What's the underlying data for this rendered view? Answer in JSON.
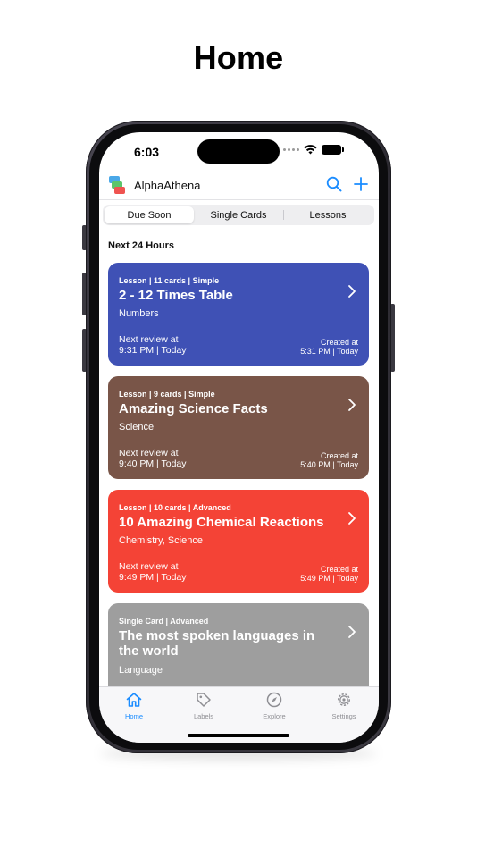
{
  "page_heading": "Home",
  "status_bar": {
    "time": "6:03"
  },
  "app": {
    "title": "AlphaAthena"
  },
  "segments": [
    {
      "label": "Due Soon",
      "active": true
    },
    {
      "label": "Single Cards",
      "active": false
    },
    {
      "label": "Lessons",
      "active": false
    }
  ],
  "section_header": "Next 24 Hours",
  "cards": [
    {
      "meta": "Lesson | 11 cards | Simple",
      "title": "2 - 12 Times Table",
      "subtitle": "Numbers",
      "review_label": "Next review at",
      "review_time": "9:31 PM | Today",
      "created_label": "Created at",
      "created_time": "5:31 PM | Today",
      "color": "#3f51b5"
    },
    {
      "meta": "Lesson | 9 cards | Simple",
      "title": "Amazing Science Facts",
      "subtitle": "Science",
      "review_label": "Next review at",
      "review_time": "9:40 PM | Today",
      "created_label": "Created at",
      "created_time": "5:40 PM | Today",
      "color": "#795548"
    },
    {
      "meta": "Lesson | 10 cards | Advanced",
      "title": "10 Amazing Chemical Reactions",
      "subtitle": "Chemistry, Science",
      "review_label": "Next review at",
      "review_time": "9:49 PM | Today",
      "created_label": "Created at",
      "created_time": "5:49 PM | Today",
      "color": "#f44336"
    },
    {
      "meta": "Single Card | Advanced",
      "title": "The most spoken languages in the world",
      "subtitle": "Language",
      "color": "#9e9e9e"
    }
  ],
  "tabs": [
    {
      "label": "Home",
      "icon": "house-icon",
      "active": true
    },
    {
      "label": "Labels",
      "icon": "tag-icon",
      "active": false
    },
    {
      "label": "Explore",
      "icon": "compass-icon",
      "active": false
    },
    {
      "label": "Settings",
      "icon": "gear-icon",
      "active": false
    }
  ],
  "colors": {
    "accent": "#1a8cff",
    "inactive": "#8e8e93"
  }
}
